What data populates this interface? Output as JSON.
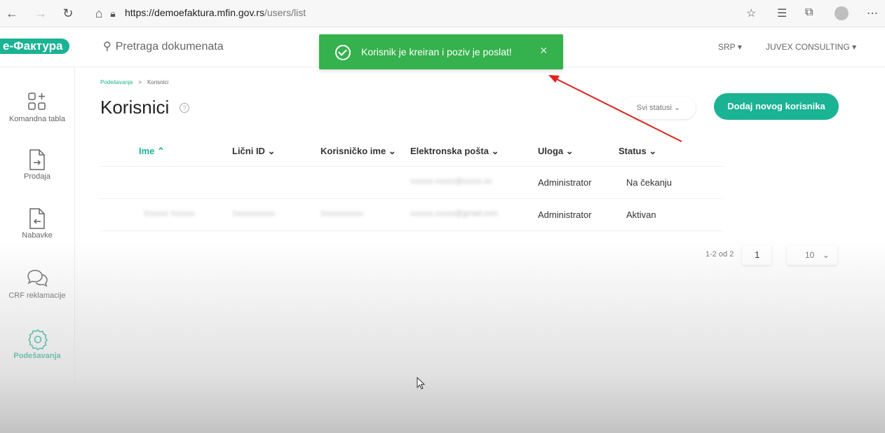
{
  "browser": {
    "url_scheme": "https://",
    "url_host": "demoefaktura.mfin.gov.rs",
    "url_path": "/users/list"
  },
  "header": {
    "logo": "e-Фактура",
    "search_placeholder": "Pretraga dokumenata",
    "language": "SRP",
    "company": "JUVEX CONSULTING"
  },
  "toast": {
    "message": "Korisnik je kreiran i poziv je poslat!",
    "close": "×",
    "color": "#35b14d"
  },
  "sidebar": {
    "items": [
      {
        "label": "Komandna tabla",
        "icon": "dashboard-icon"
      },
      {
        "label": "Prodaja",
        "icon": "sales-doc-icon"
      },
      {
        "label": "Nabavke",
        "icon": "purchase-doc-icon"
      },
      {
        "label": "CRF reklamacije",
        "icon": "chat-icon"
      },
      {
        "label": "Podešavanja",
        "icon": "gear-icon",
        "active": true
      }
    ]
  },
  "breadcrumb": {
    "parent": "Podešavanja",
    "separator": ">",
    "current": "Korisnici"
  },
  "page": {
    "title": "Korisnici",
    "help": "?",
    "status_filter": "Svi statusi",
    "add_button": "Dodaj novog korisnika",
    "accent": "#1ab394"
  },
  "table": {
    "columns": [
      "Ime",
      "Lični ID",
      "Korisničko ime",
      "Elektronska pošta",
      "Uloga",
      "Status"
    ],
    "rows": [
      {
        "name": "",
        "id": "",
        "username": "",
        "email": "xxxxxx.xxxxx@xxxxx.xx",
        "role": "Administrator",
        "status": "Na čekanju"
      },
      {
        "name": "Xxxxxx Xxxxxx",
        "id": "1xxxxxxxxxx",
        "username": "1xxxxxxxxxx",
        "email": "xxxxxx.xxxxx@gmail.com",
        "role": "Administrator",
        "status": "Aktivan"
      }
    ]
  },
  "pagination": {
    "range": "1-2 od 2",
    "page": "1",
    "per_page": "10"
  }
}
